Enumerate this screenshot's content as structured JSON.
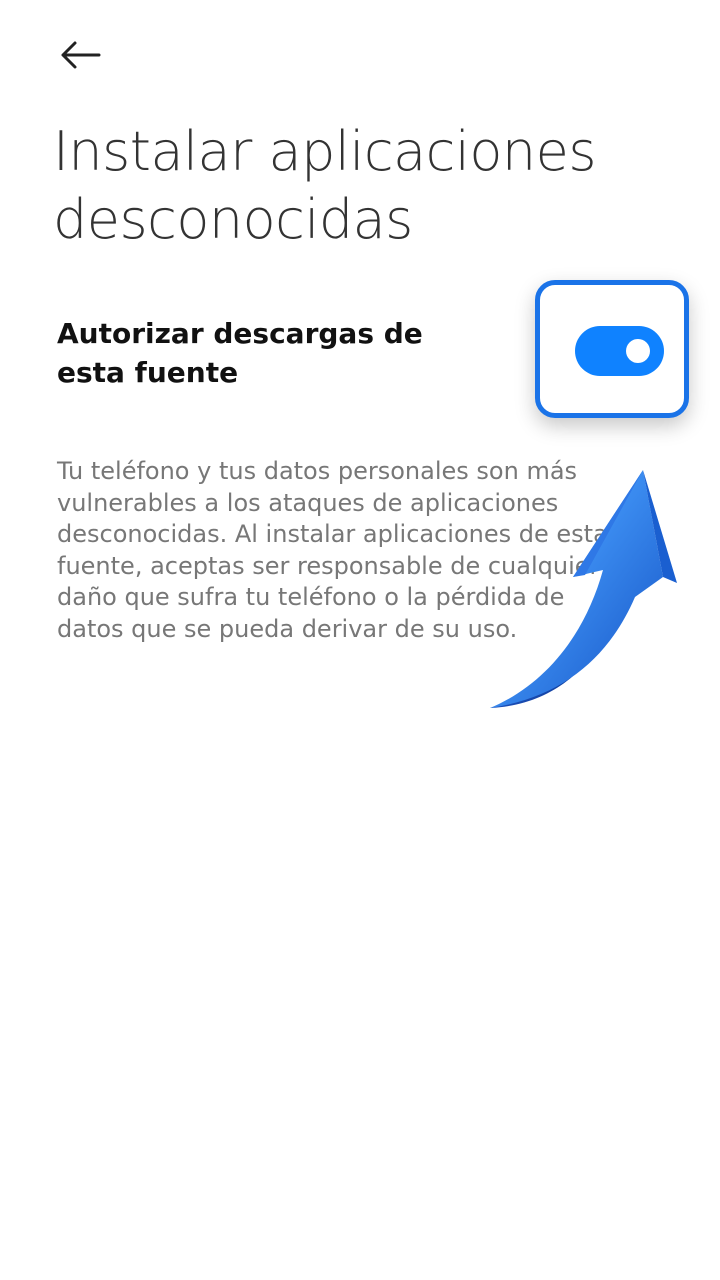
{
  "header": {
    "back_icon": "arrow-left-icon"
  },
  "page": {
    "title": "Instalar aplicaciones desconocidas"
  },
  "setting": {
    "label": "Autorizar descargas de esta fuente",
    "enabled": true,
    "toggle_color": "#0f82ff"
  },
  "description": {
    "text": "Tu teléfono y tus datos personales son más vulnerables a los ataques de aplicaciones desconocidas. Al instalar aplicaciones de esta fuente, aceptas ser responsable de cualquier daño que sufra tu teléfono o la pérdida de datos que se pueda derivar de su uso."
  },
  "annotation": {
    "highlight_color": "#1a73e8",
    "arrow_icon": "curved-arrow-up-icon",
    "arrow_color": "#3b8cf0"
  }
}
